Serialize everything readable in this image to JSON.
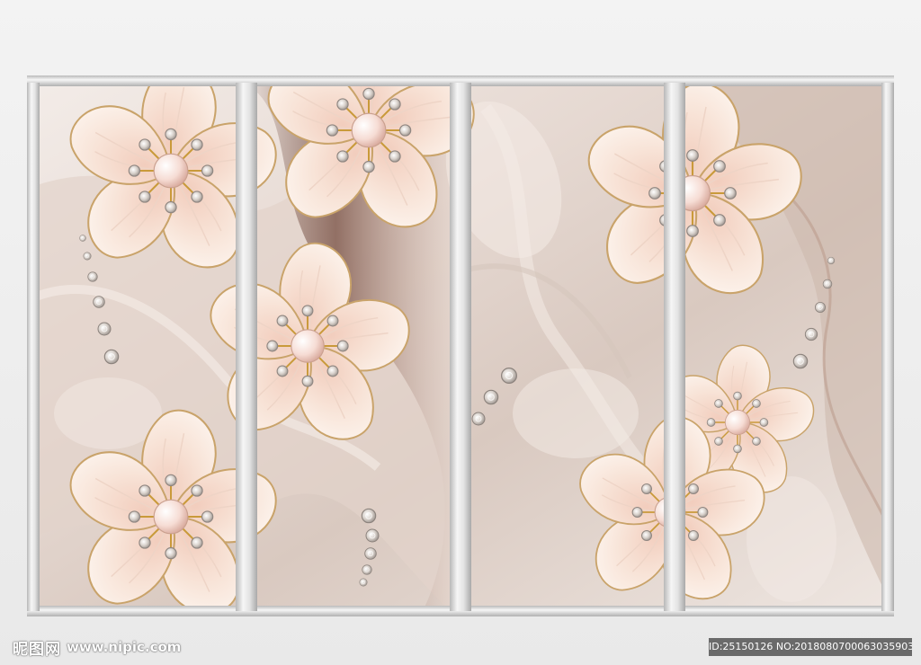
{
  "watermark": {
    "logo_text": "昵图网",
    "url_text": "www.nipic.com",
    "id_text": "ID:25150126 NO:20180807000630359033"
  },
  "artwork": {
    "panels": 4,
    "colors": {
      "frame": "#c9c9c9",
      "frame_highlight": "#f7f7f7",
      "silk_light": "#eee4dd",
      "silk_dark": "#7a4f40",
      "petal": "#f6ddcf",
      "petal_edge": "#c9a36a",
      "pearl": "#fbeee8",
      "gem": "#d9d2cc"
    },
    "icons": [
      "flower-icon",
      "pearl-icon",
      "diamond-icon"
    ]
  }
}
